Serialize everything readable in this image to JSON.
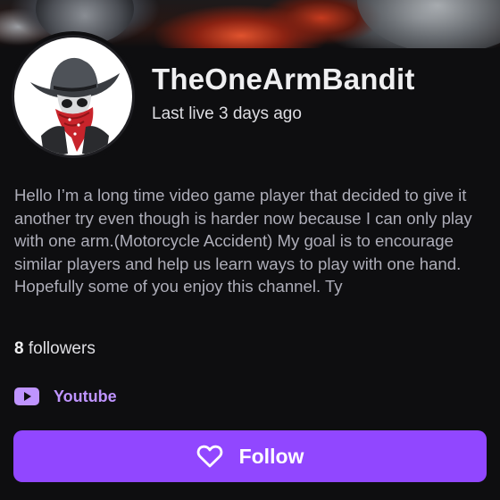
{
  "channel": {
    "name": "TheOneArmBandit",
    "last_live": "Last live 3 days ago"
  },
  "bio": "Hello I’m a long time video game player that decided to give it another try even though is harder now because I can only play with one arm.(Motorcycle Accident) My goal is to encourage similar players and help us learn ways to play with one hand. Hopefully some of you enjoy this channel. Ty",
  "followers": {
    "count": "8",
    "label": "followers"
  },
  "social_links": [
    {
      "icon": "youtube-icon",
      "label": "Youtube"
    }
  ],
  "follow_button": {
    "label": "Follow",
    "icon": "heart-icon"
  },
  "colors": {
    "background": "#0e0e10",
    "accent": "#9147ff",
    "link": "#bf94ff",
    "text_primary": "#efeff1",
    "text_secondary": "#adadb8"
  }
}
